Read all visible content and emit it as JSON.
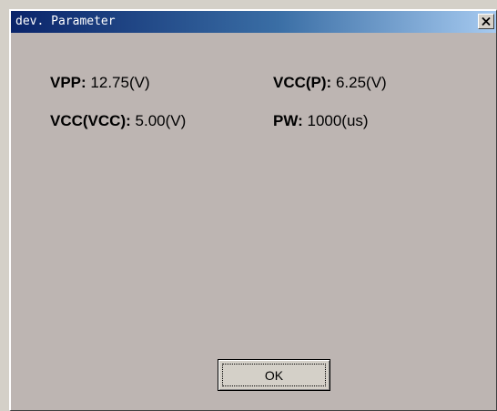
{
  "window": {
    "title": "dev. Parameter",
    "close_icon": "close-icon"
  },
  "parameters": [
    {
      "label": "VPP:",
      "value": "12.75(V)"
    },
    {
      "label": "VCC(P):",
      "value": "6.25(V)"
    },
    {
      "label": "VCC(VCC):",
      "value": "5.00(V)"
    },
    {
      "label": "PW:",
      "value": "1000(us)"
    }
  ],
  "buttons": {
    "ok_label": "OK"
  }
}
